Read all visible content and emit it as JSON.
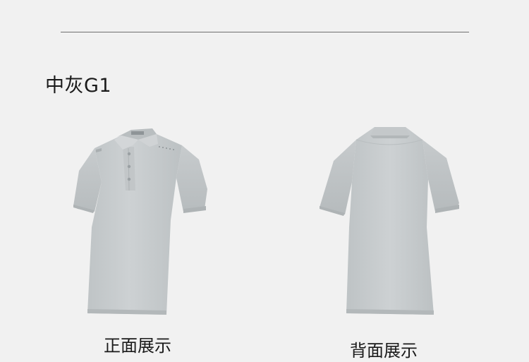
{
  "product": {
    "color_name": "中灰G1",
    "shirt_color": "#c9cdcf"
  },
  "views": {
    "front_label": "正面展示",
    "back_label": "背面展示"
  }
}
